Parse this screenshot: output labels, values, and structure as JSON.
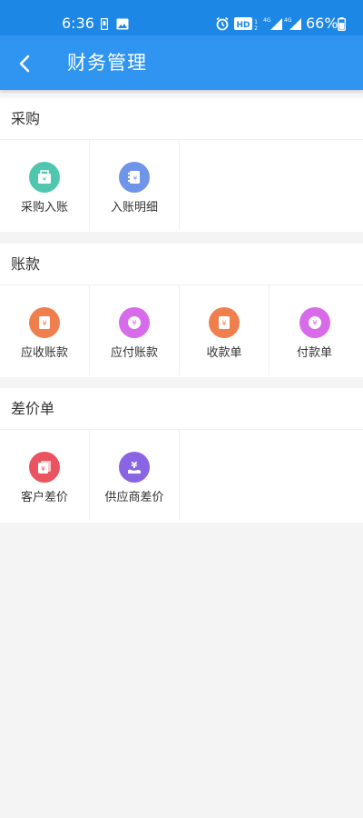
{
  "status_bar": {
    "time": "6:36",
    "battery": "66%"
  },
  "header": {
    "title": "财务管理"
  },
  "sections": [
    {
      "title": "采购",
      "items": [
        {
          "label": "采购入账",
          "icon": "purchase-entry-icon",
          "color": "#4fc7ae"
        },
        {
          "label": "入账明细",
          "icon": "entry-detail-icon",
          "color": "#6f95e9"
        }
      ]
    },
    {
      "title": "账款",
      "items": [
        {
          "label": "应收账款",
          "icon": "receivable-icon",
          "color": "#ef7f4d"
        },
        {
          "label": "应付账款",
          "icon": "payable-icon",
          "color": "#d86be9"
        },
        {
          "label": "收款单",
          "icon": "receipt-icon",
          "color": "#ef7f4d"
        },
        {
          "label": "付款单",
          "icon": "payment-icon",
          "color": "#d86be9"
        }
      ]
    },
    {
      "title": "差价单",
      "items": [
        {
          "label": "客户差价",
          "icon": "customer-diff-icon",
          "color": "#ea5360"
        },
        {
          "label": "供应商差价",
          "icon": "supplier-diff-icon",
          "color": "#8a65e3"
        }
      ]
    }
  ]
}
